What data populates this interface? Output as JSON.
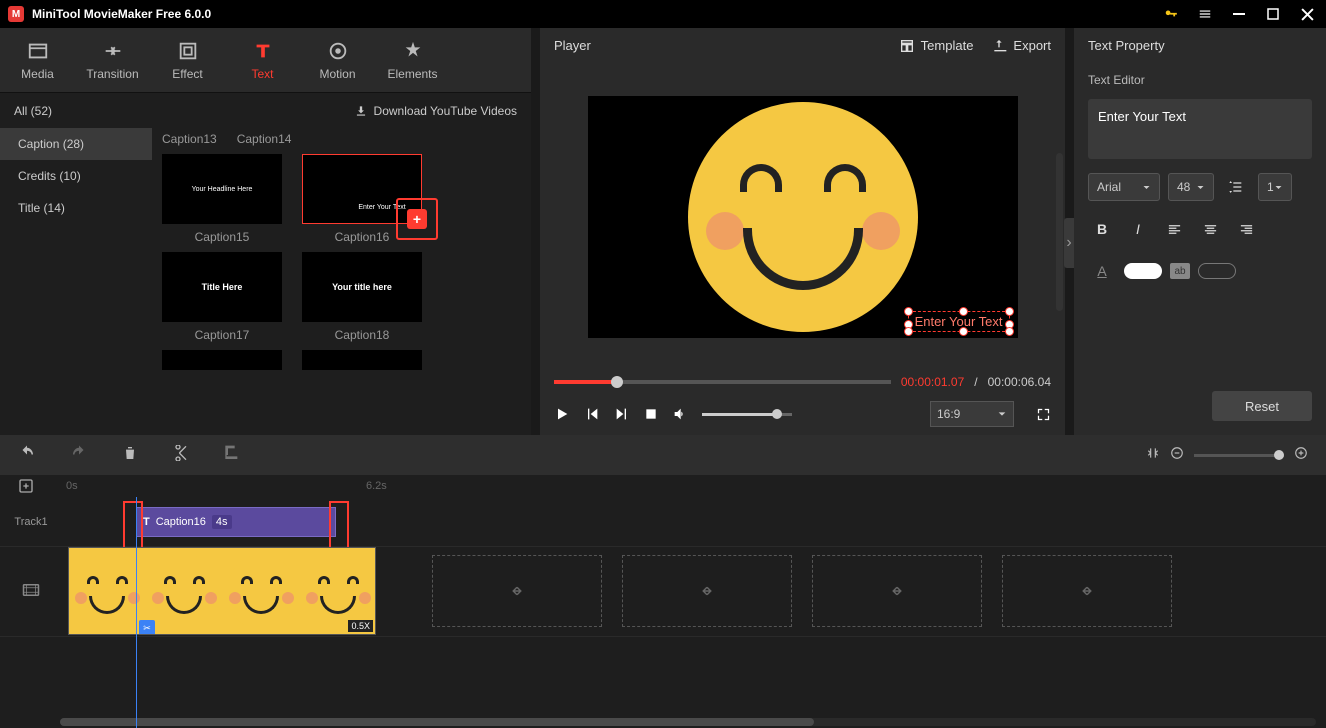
{
  "app": {
    "title": "MiniTool MovieMaker Free 6.0.0"
  },
  "mainTabs": {
    "media": "Media",
    "transition": "Transition",
    "effect": "Effect",
    "text": "Text",
    "motion": "Motion",
    "elements": "Elements"
  },
  "subheader": {
    "all": "All (52)",
    "download": "Download YouTube Videos"
  },
  "categories": {
    "caption": "Caption (28)",
    "credits": "Credits (10)",
    "title": "Title (14)"
  },
  "thumbs": {
    "c13": "Caption13",
    "c14": "Caption14",
    "c15": "Caption15",
    "c16": "Caption16",
    "c17": "Caption17",
    "c18": "Caption18",
    "t15": "Your Headline Here",
    "t16": "Enter Your Text",
    "t17": "Title Here",
    "t18": "Your title here"
  },
  "player": {
    "title": "Player",
    "template": "Template",
    "export": "Export",
    "overlay": "Enter Your Text",
    "currentTime": "00:00:01.07",
    "totalTime": "00:00:06.04",
    "aspect": "16:9",
    "sep": " / "
  },
  "textprop": {
    "title": "Text Property",
    "editor": "Text Editor",
    "placeholder": "Enter Your Text",
    "font": "Arial",
    "size": "48",
    "line": "1",
    "reset": "Reset",
    "hl": "ab"
  },
  "timeline": {
    "t0": "0s",
    "t1": "6.2s",
    "track1": "Track1",
    "captionClip": "Caption16",
    "captionDur": "4s",
    "speed": "0.5X"
  }
}
